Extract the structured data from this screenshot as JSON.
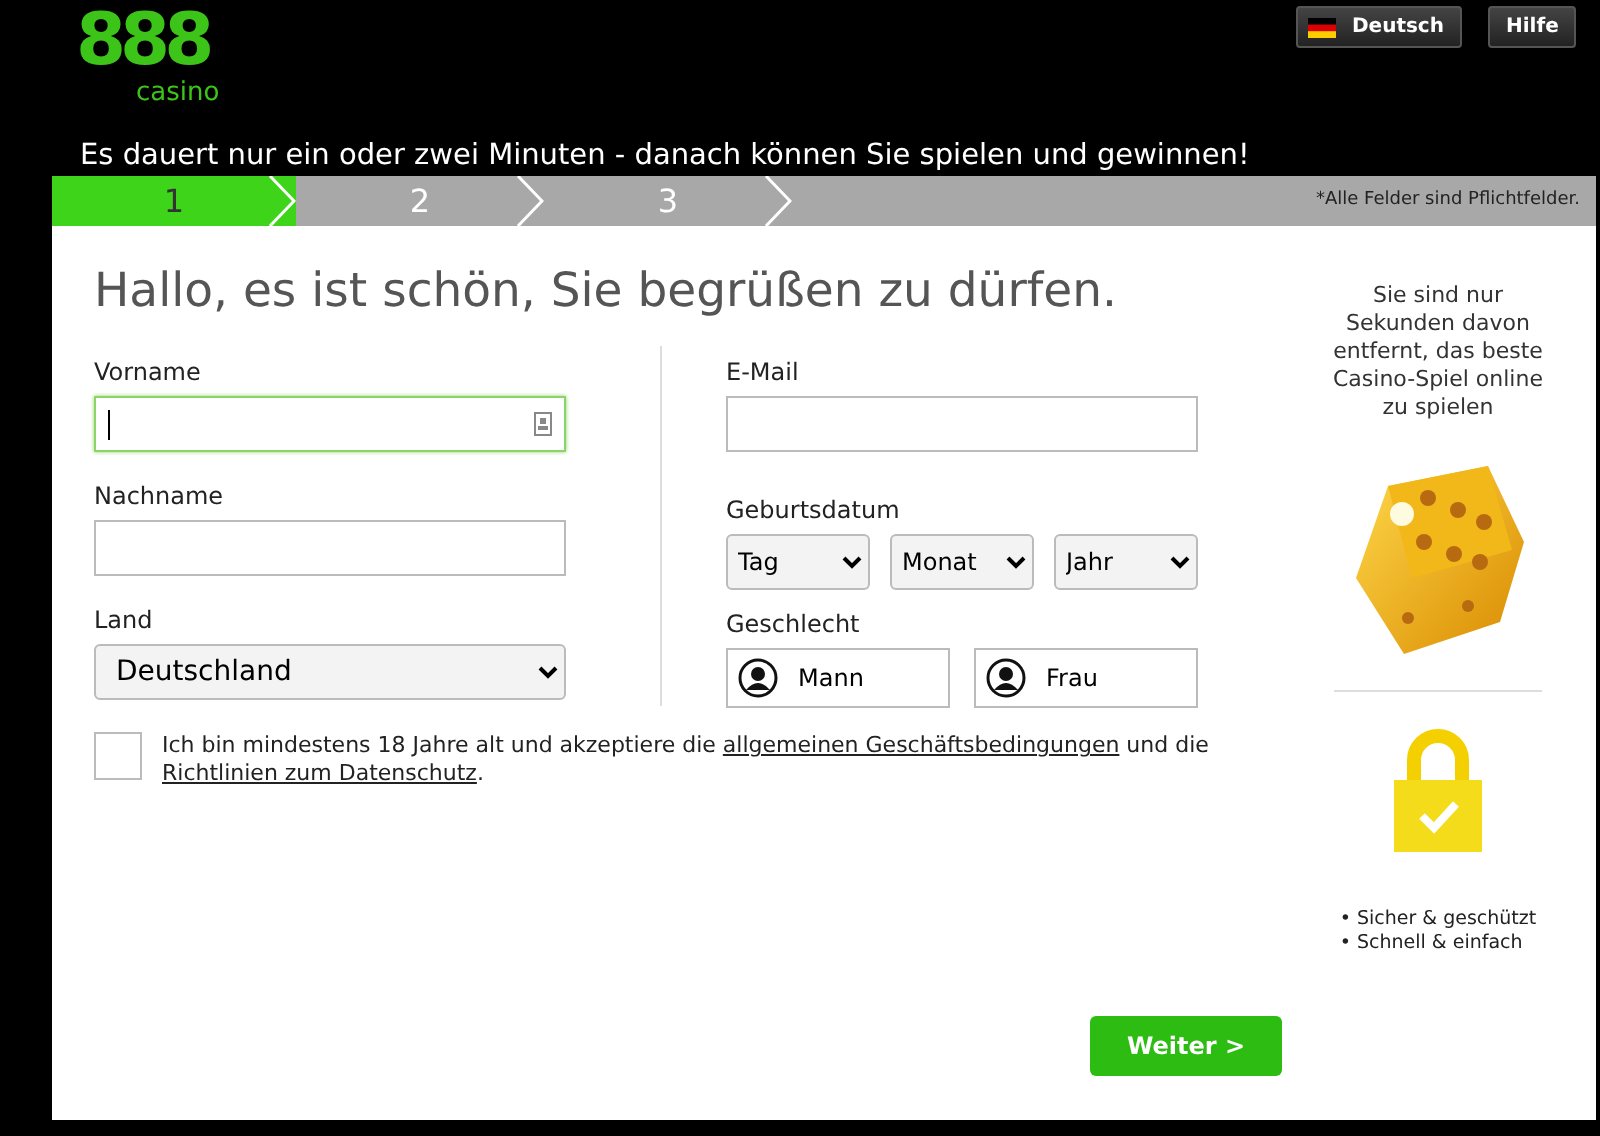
{
  "logo": {
    "mark": "888",
    "word": "casino"
  },
  "header_buttons": [
    {
      "label": "Deutsch",
      "kind": "language"
    },
    {
      "label": "Hilfe",
      "kind": "help"
    }
  ],
  "tagline": "Es dauert nur ein oder zwei Minuten - danach können Sie spielen und gewinnen!",
  "steps": [
    {
      "label": "1",
      "selected": true
    },
    {
      "label": "2",
      "selected": false
    },
    {
      "label": "3",
      "selected": false
    }
  ],
  "required_note": "*Alle Felder sind Pflichtfelder.",
  "heading": "Hallo, es ist schön, Sie begrüßen zu dürfen.",
  "left_fields": [
    {
      "label": "Vorname",
      "kind": "text",
      "focused": true
    },
    {
      "label": "Nachname",
      "kind": "text",
      "focused": false
    },
    {
      "label": "Land",
      "kind": "select",
      "value": "Deutschland"
    }
  ],
  "email": {
    "label": "E-Mail",
    "focused": false
  },
  "birthdate": {
    "label": "Geburtsdatum",
    "selects": [
      "Tag",
      "Monat",
      "Jahr"
    ]
  },
  "gender": {
    "label": "Geschlecht",
    "options": [
      {
        "label": "Mann",
        "selected": false
      },
      {
        "label": "Frau",
        "selected": false
      }
    ]
  },
  "consent": {
    "checked": false,
    "text_before": "Ich bin mindestens 18 Jahre alt und akzeptiere die ",
    "link1": "allgemeinen Geschäftsbedingungen",
    "text_middle": " und die ",
    "link2": "Richtlinien zum Datenschutz",
    "text_after": "."
  },
  "submit": "Weiter >",
  "promo": {
    "text": "Sie sind nur Sekunden davon entfernt, das beste Casino-Spiel online zu spielen",
    "bullets": [
      "• Sicher & geschützt",
      "• Schnell & einfach"
    ]
  }
}
